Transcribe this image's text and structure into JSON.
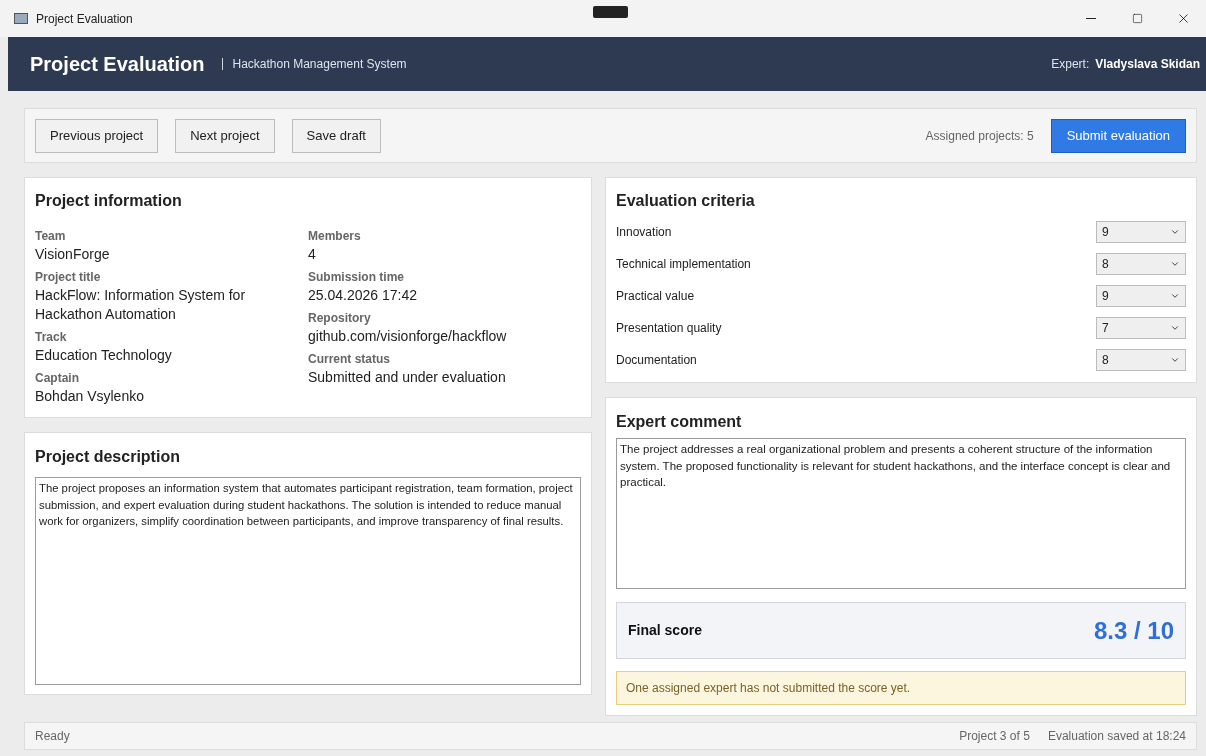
{
  "window": {
    "title": "Project Evaluation"
  },
  "header": {
    "title": "Project Evaluation",
    "subtitle": "Hackathon Management System",
    "expert_label": "Expert:",
    "expert_name": "Vladyslava Skidan"
  },
  "toolbar": {
    "buttons": [
      "Previous project",
      "Next project",
      "Save draft"
    ],
    "assigned": "Assigned projects: 5",
    "primary_button": "Submit evaluation"
  },
  "project_information": {
    "title": "Project information",
    "left": [
      {
        "label": "Team",
        "value": "VisionForge"
      },
      {
        "label": "Project title",
        "value": "HackFlow: Information System for Hackathon Automation"
      },
      {
        "label": "Track",
        "value": "Education Technology"
      },
      {
        "label": "Captain",
        "value": "Bohdan Vsylenko"
      }
    ],
    "right": [
      {
        "label": "Members",
        "value": "4"
      },
      {
        "label": "Submission time",
        "value": "25.04.2026 17:42"
      },
      {
        "label": "Repository",
        "value": "github.com/visionforge/hackflow"
      },
      {
        "label": "Current status",
        "value": "Submitted and under evaluation"
      }
    ]
  },
  "project_description": {
    "title": "Project description",
    "text": "The project proposes an information system that automates participant registration, team formation, project submission, and expert evaluation during student hackathons. The solution is intended to reduce manual work for organizers, simplify coordination between participants, and improve transparency of final results."
  },
  "evaluation_criteria": {
    "title": "Evaluation criteria",
    "items": [
      {
        "name": "Innovation",
        "score": "9"
      },
      {
        "name": "Technical implementation",
        "score": "8"
      },
      {
        "name": "Practical value",
        "score": "9"
      },
      {
        "name": "Presentation quality",
        "score": "7"
      },
      {
        "name": "Documentation",
        "score": "8"
      }
    ]
  },
  "expert_comment": {
    "title": "Expert comment",
    "text": "The project addresses a real organizational problem and presents a coherent structure of the information system. The proposed functionality is relevant for student hackathons, and the interface concept is clear and practical."
  },
  "final_score": {
    "label": "Final score",
    "value": "8.3 / 10"
  },
  "warning": "One assigned expert has not submitted the score yet.",
  "status_bar": {
    "left": "Ready",
    "project": "Project 3 of 5",
    "saved": "Evaluation saved at 18:24"
  }
}
